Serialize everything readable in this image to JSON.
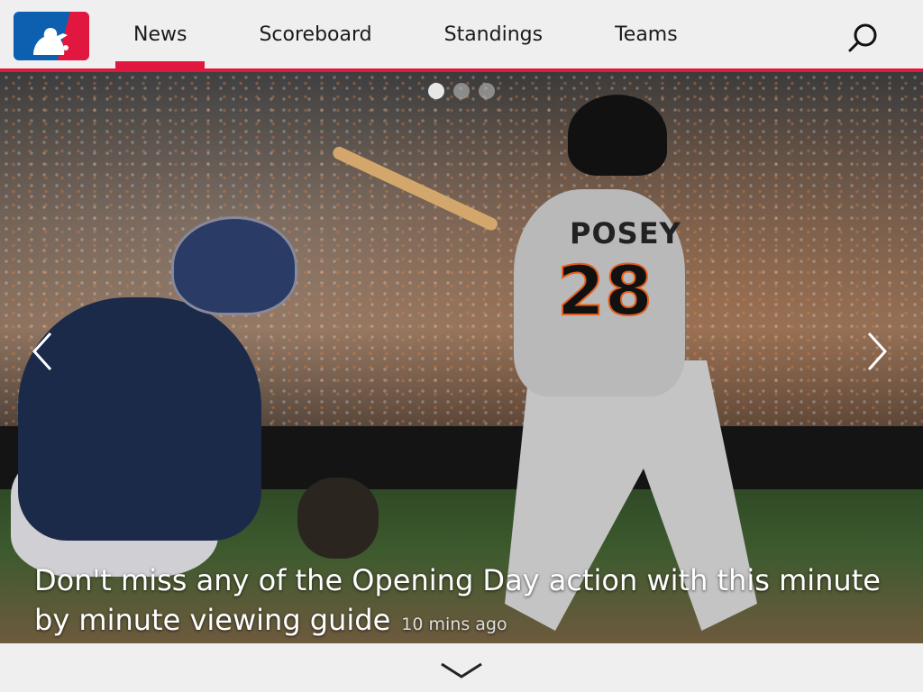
{
  "app": {
    "brand_icon": "mlb-logo-icon",
    "colors": {
      "accent": "#e1173f",
      "brand_blue": "#0d5fb0"
    }
  },
  "nav": {
    "items": [
      {
        "label": "News",
        "active": true
      },
      {
        "label": "Scoreboard",
        "active": false
      },
      {
        "label": "Standings",
        "active": false
      },
      {
        "label": "Teams",
        "active": false
      }
    ],
    "search_icon": "search-icon"
  },
  "carousel": {
    "slide_count": 3,
    "active_index": 0,
    "prev_icon": "chevron-left-icon",
    "next_icon": "chevron-right-icon",
    "jersey": {
      "name": "POSEY",
      "number": "28"
    },
    "headline": "Don't miss any of the Opening Day action with this minute by minute viewing guide",
    "timestamp": "10 mins ago"
  },
  "footer": {
    "expand_icon": "chevron-down-icon"
  }
}
